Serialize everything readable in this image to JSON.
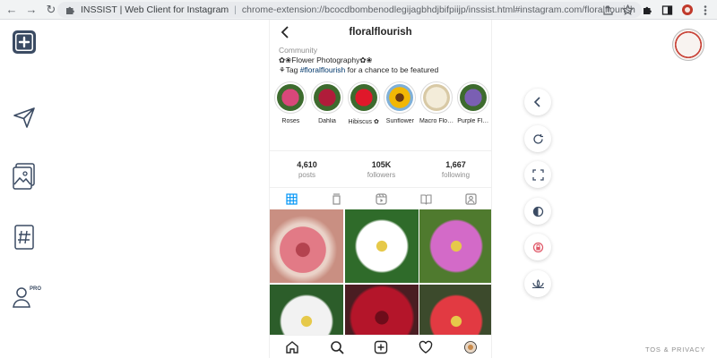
{
  "browser": {
    "title": "INSSIST | Web Client for Instagram",
    "url": "chrome-extension://bcocdbombenodlegijagbhdjbifpiijp/inssist.html#instagram.com/floralflourish"
  },
  "left_rail": [
    {
      "icon": "new-post-icon"
    },
    {
      "icon": "send-icon"
    },
    {
      "icon": "gallery-icon"
    },
    {
      "icon": "hashtag-icon"
    },
    {
      "icon": "profile-pro-icon",
      "badge": "PRO"
    }
  ],
  "profile": {
    "username": "floralflourish",
    "category": "Community",
    "bio_line1": "✿❀Flower Photography✿❀",
    "bio_line2_prefix": "⚘Tag ",
    "bio_hashtag": "#floralflourish",
    "bio_line2_suffix": " for a chance to be featured",
    "highlights": [
      {
        "label": "Roses",
        "color": "#d9477a"
      },
      {
        "label": "Dahlia",
        "color": "#b01c3a"
      },
      {
        "label": "Hibiscus ✿",
        "color": "#e0182a"
      },
      {
        "label": "Sunflower",
        "color": "#f2b705"
      },
      {
        "label": "Macro Flo…",
        "color": "#d8c9a5"
      },
      {
        "label": "Purple Fl…",
        "color": "#7a5fb3"
      }
    ],
    "stats": [
      {
        "value": "4,610",
        "label": "posts"
      },
      {
        "value": "105K",
        "label": "followers"
      },
      {
        "value": "1,667",
        "label": "following"
      }
    ],
    "tabs": [
      "grid-tab",
      "igtv-tab",
      "reels-tab",
      "guides-tab",
      "tagged-tab"
    ],
    "posts": [
      {
        "bg": "#c98f82",
        "petal": "#e27a86"
      },
      {
        "bg": "#2f6b2a",
        "petal": "#ffffff"
      },
      {
        "bg": "#4f7a2e",
        "petal": "#d36ac8"
      },
      {
        "bg": "#2c5d2a",
        "petal": "#f2f2f2"
      },
      {
        "bg": "#4a1d22",
        "petal": "#b4152a"
      },
      {
        "bg": "#3c4a2c",
        "petal": "#e23a42"
      }
    ]
  },
  "tos": "TOS & PRIVACY"
}
